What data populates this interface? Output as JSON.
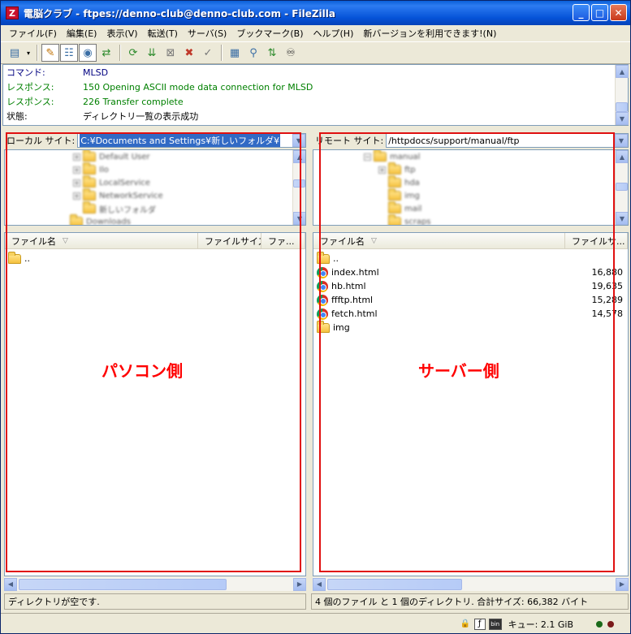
{
  "window": {
    "title": "電脳クラブ - ftpes://denno-club@denno-club.com - FileZilla",
    "icon_letter": "Z",
    "controls": [
      "minimize-icon",
      "maximize-icon",
      "close-icon"
    ]
  },
  "menu": [
    "ファイル(F)",
    "編集(E)",
    "表示(V)",
    "転送(T)",
    "サーバ(S)",
    "ブックマーク(B)",
    "ヘルプ(H)",
    "新バージョンを利用できます!(N)"
  ],
  "log": [
    {
      "label": "コマンド:",
      "text": "MLSD",
      "color": "#000080"
    },
    {
      "label": "レスポンス:",
      "text": "150 Opening ASCII mode data connection for MLSD",
      "color": "#008000"
    },
    {
      "label": "レスポンス:",
      "text": "226 Transfer complete",
      "color": "#008000"
    },
    {
      "label": "状態:",
      "text": "ディレクトリ一覧の表示成功",
      "color": "#000000"
    }
  ],
  "local": {
    "site_label": "ローカル サイト:",
    "path": "C:¥Documents and Settings¥新しいフォルダ¥",
    "tree": [
      "Default User",
      "Ilo",
      "LocalService",
      "NetworkService",
      "新しいフォルダ",
      "Downloads"
    ],
    "columns": [
      "ファイル名",
      "ファイルサイズ",
      "ファ..."
    ],
    "files": [
      ".."
    ],
    "status": "ディレクトリが空です.",
    "annotation": "パソコン側"
  },
  "remote": {
    "site_label": "リモート サイト:",
    "path": "/httpdocs/support/manual/ftp",
    "tree": [
      "manual",
      "ftp",
      "hda",
      "img",
      "mail",
      "scraps"
    ],
    "columns": [
      "ファイル名",
      "ファイルサ..."
    ],
    "files": [
      {
        "name": "..",
        "size": "",
        "type": "folder"
      },
      {
        "name": "index.html",
        "size": "16,880",
        "type": "html"
      },
      {
        "name": "hb.html",
        "size": "19,635",
        "type": "html"
      },
      {
        "name": "ffftp.html",
        "size": "15,289",
        "type": "html"
      },
      {
        "name": "fetch.html",
        "size": "14,578",
        "type": "html"
      },
      {
        "name": "img",
        "size": "",
        "type": "folder"
      }
    ],
    "status": "4 個のファイル と 1 個のディレクトリ. 合計サイズ: 66,382 バイト",
    "annotation": "サーバー側"
  },
  "bottom": {
    "queue": "キュー: 2.1 GiB"
  },
  "colors": {
    "annotation": "#ff0000",
    "selection": "#316ac5"
  }
}
